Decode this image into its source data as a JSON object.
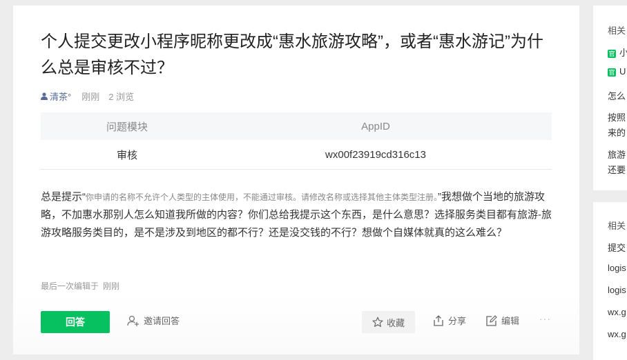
{
  "question": {
    "title": "个人提交更改小程序昵称更改成“惠水旅游攻略”，或者“惠水游记”为什么总是审核不过？",
    "author": "清茶°",
    "time": "刚刚",
    "views": "2 浏览"
  },
  "info_table": {
    "headers": [
      "问题模块",
      "AppID"
    ],
    "row": [
      "审核",
      "wx00f23919cd316c13"
    ]
  },
  "content": {
    "prefix": "总是提示“",
    "hint": "你申请的名称不允许个人类型的主体使用，不能通过审核。请修改名称或选择其他主体类型注册。",
    "suffix": "”我想做个当地的旅游攻略，不加惠水那别人怎么知道我所做的内容？你们总给我提示这个东西，是什么意思？选择服务类目都有旅游-旅游攻略服务类目的，是不是涉及到地区的都不行？还是没交钱的不行？想做个自媒体就真的这么难么？"
  },
  "edited": {
    "label": "最后一次编辑于",
    "time": "刚刚"
  },
  "actions": {
    "answer": "回答",
    "invite": "邀请回答",
    "favorite": "收藏",
    "share": "分享",
    "edit": "编辑",
    "more": "···"
  },
  "sidebar1": {
    "heading": "相关",
    "official_badge": "官",
    "items": [
      "小",
      "U",
      "怎么",
      "按照",
      "来的",
      "旅游",
      "还要"
    ]
  },
  "sidebar2": {
    "heading": "相关",
    "items": [
      "提交",
      "logis",
      "logis",
      "wx.g",
      "wx.g"
    ]
  },
  "colors": {
    "accent": "#07c160",
    "author_link": "#576b95",
    "background": "#ededed"
  }
}
